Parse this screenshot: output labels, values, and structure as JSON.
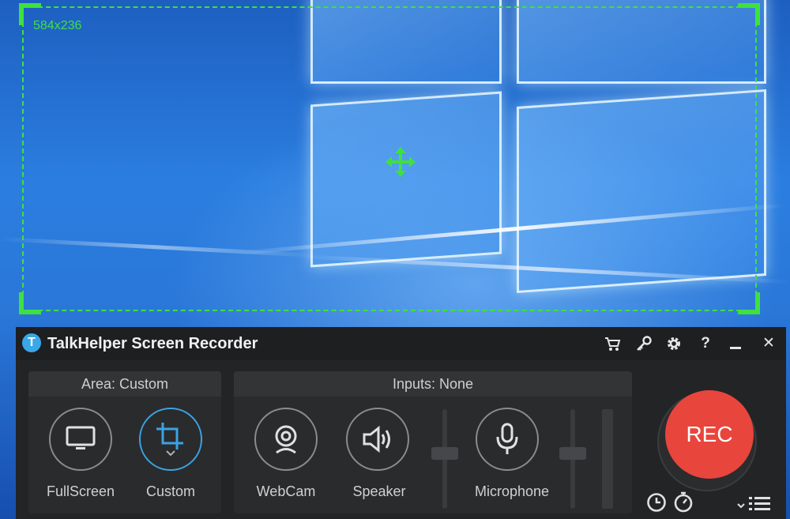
{
  "capture": {
    "dimensions": "584x236"
  },
  "app": {
    "title": "TalkHelper Screen Recorder",
    "logo_letter": "T",
    "titlebar_icons": [
      "cart-icon",
      "key-icon",
      "gear-icon",
      "help-icon",
      "minimize-icon",
      "close-icon"
    ],
    "help_glyph": "?",
    "close_glyph": "✕"
  },
  "area": {
    "header": "Area: Custom",
    "fullscreen_label": "FullScreen",
    "custom_label": "Custom"
  },
  "inputs": {
    "header": "Inputs: None",
    "webcam_label": "WebCam",
    "speaker_label": "Speaker",
    "microphone_label": "Microphone"
  },
  "record": {
    "label": "REC"
  },
  "colors": {
    "accent_blue": "#3aa3e3",
    "rec_red": "#e8453c",
    "selection_green": "#3fe03f"
  }
}
